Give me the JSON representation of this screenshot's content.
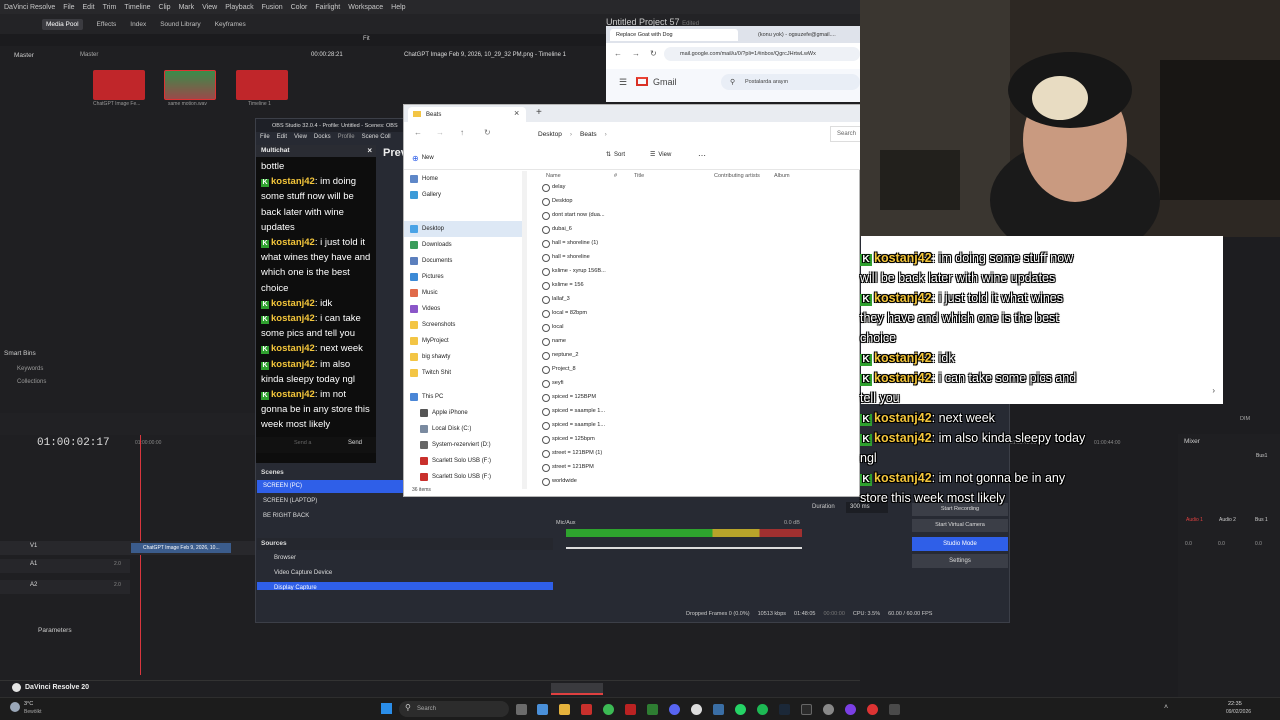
{
  "resolve": {
    "app_title": "DaVinci Resolve",
    "menu": [
      "DaVinci Resolve",
      "File",
      "Edit",
      "Trim",
      "Timeline",
      "Clip",
      "Mark",
      "View",
      "Playback",
      "Fusion",
      "Color",
      "Fairlight",
      "Workspace",
      "Help"
    ],
    "toolbar": {
      "media_pool": "Media Pool",
      "effects": "Effects",
      "index": "Index",
      "sound_library": "Sound Library",
      "keyframes": "Keyframes",
      "fit": "Fit"
    },
    "bins_master_left": "Master",
    "bins_master": "Master",
    "timecode_top": "00:00:28:21",
    "clip_title": "ChatGPT Image Feb 9, 2026, 10_29_32 PM.png - Timeline 1",
    "media": [
      {
        "label": "ChatGPT Image Fe..."
      },
      {
        "label": "same motion.wav"
      },
      {
        "label": "Timeline 1"
      }
    ],
    "smart_bins": "Smart Bins",
    "keywords": "Keywords",
    "collections": "Collections",
    "timecode_main": "01:00:02:17",
    "ruler_left": "01:00:00:00",
    "ruler_mid": "01:00:42:00",
    "ruler_right": "01:00:44:00",
    "tracks": [
      "V1",
      "A1",
      "A2"
    ],
    "track_vals": [
      "2.0",
      "2.0"
    ],
    "clip_label": "ChatGPT Image Feb 9, 2026, 10...",
    "parameters": "Parameters",
    "brand": "DaVinci Resolve 20",
    "mixer": "Mixer",
    "mixer_channels": [
      "Audio 1",
      "Audio 2",
      "Bus 1"
    ],
    "mixer_bus_label": "Bus1",
    "mixer_vals": [
      "0.0",
      "0.0",
      "0.0"
    ],
    "dim": "DIM"
  },
  "project_title": "Untitled Project 57",
  "project_status": "Edited",
  "obs": {
    "title": "OBS Studio 32.0.4 - Profile: Untitled - Scenes: OBS",
    "menu": [
      "File",
      "Edit",
      "View",
      "Docks",
      "Profile",
      "Scene Coll"
    ],
    "multichat_title": "Multichat",
    "preview_label": "Prev",
    "send_placeholder": "Send a",
    "send_button": "Send",
    "scenes_header": "Scenes",
    "scenes": [
      "SCREEN (PC)",
      "SCREEN (LAPTOP)",
      "BE RIGHT BACK"
    ],
    "sources_header": "Sources",
    "sources": [
      "Browser",
      "Video Capture Device",
      "Display Capture"
    ],
    "mic_label": "Mic/Aux",
    "mic_db": "0.0 dB",
    "meter_ticks": [
      "-60",
      "-55",
      "-50",
      "-45",
      "-40",
      "-35",
      "-30",
      "-25",
      "-20",
      "-15",
      "-10",
      "-5",
      "0"
    ],
    "duration_label": "Duration",
    "duration_val": "300 ms",
    "start_streaming": "Start Streaming",
    "start_recording": "Start Recording",
    "start_virtual_camera": "Start Virtual Camera",
    "studio_mode": "Studio Mode",
    "settings": "Settings",
    "status": {
      "dropped": "Dropped Frames 0 (0.0%)",
      "kbps": "10513 kbps",
      "time1": "01:48:05",
      "time2": "00:00:00",
      "cpu": "CPU: 3.5%",
      "fps": "60.00 / 60.00 FPS"
    }
  },
  "chat_messages": [
    {
      "user": "",
      "text": "bottle"
    },
    {
      "user": "kostanj42",
      "text": "im doing some stuff now will be back later with wine updates"
    },
    {
      "user": "kostanj42",
      "text": "i just told it what wines they have and which one is the best choice"
    },
    {
      "user": "kostanj42",
      "text": "idk"
    },
    {
      "user": "kostanj42",
      "text": "i can take some pics and tell you"
    },
    {
      "user": "kostanj42",
      "text": "next week"
    },
    {
      "user": "kostanj42",
      "text": "im also kinda sleepy today ngl"
    },
    {
      "user": "kostanj42",
      "text": "im not gonna be in any store this week most likely"
    }
  ],
  "explorer": {
    "tab_title": "Beats",
    "breadcrumb": [
      "Desktop",
      "Beats"
    ],
    "search_placeholder": "Search",
    "new_label": "New",
    "sort_label": "Sort",
    "view_label": "View",
    "columns": [
      "Name",
      "#",
      "Title",
      "Contributing artists",
      "Album"
    ],
    "sidebar": [
      "Home",
      "Gallery",
      "Desktop",
      "Downloads",
      "Documents",
      "Pictures",
      "Music",
      "Videos",
      "Screenshots",
      "MyProject",
      "big shawty",
      "Twitch Shit",
      "This PC",
      "Apple iPhone",
      "Local Disk (C:)",
      "System-rezerviert (D:)",
      "Scarlett Solo USB (F:)",
      "Scarlett Solo USB (F:)"
    ],
    "files": [
      "delay",
      "Desktop",
      "dont start now (dua...",
      "dubai_6",
      "hall = shoreline (1)",
      "hall = shoreline",
      "kslime - xyrup 156B...",
      "kslime = 156",
      "lallaf_3",
      "local = 82bpm",
      "local",
      "name",
      "neptune_2",
      "Project_8",
      "seyfi",
      "spiced = 125BPM",
      "spiced = saample 1...",
      "spiced = saample 1...",
      "spiced = 125bpm",
      "street = 121BPM (1)",
      "street = 121BPM",
      "worldwide"
    ],
    "item_count": "36 items"
  },
  "browser": {
    "tabs": [
      "Replace Goat with Dog",
      "(konu yok) - ogsuzefe@gmail...."
    ],
    "url": "mail.google.com/mail/u/0/?pli=1#inbox/QgrcJHrtwLwWx",
    "gmail_label": "Gmail",
    "search_placeholder": "Postalarda arayın"
  },
  "taskbar": {
    "weather_temp": "3°C",
    "weather_desc": "Bewölkt",
    "search_placeholder": "Search",
    "time": "22:35",
    "date": "09/02/2026"
  },
  "colors": {
    "accent_blue": "#2f5fe8",
    "chat_user": "#f4c63b",
    "badge_green": "#2fa12f"
  }
}
